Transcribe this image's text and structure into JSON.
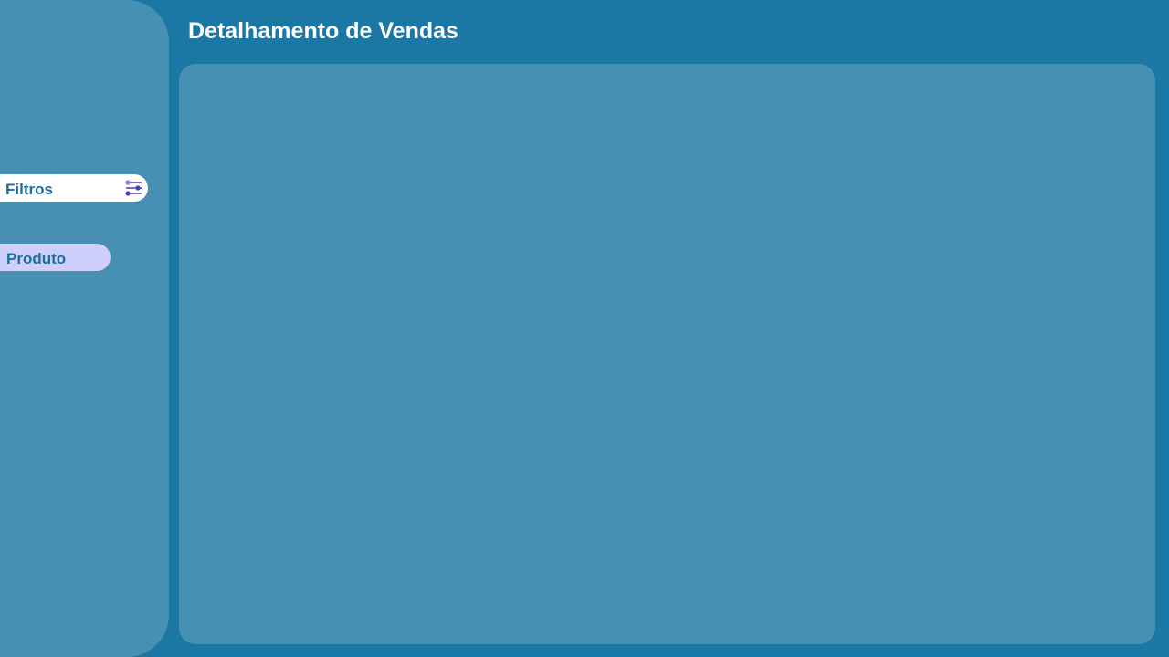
{
  "header": {
    "title": "Detalhamento de Vendas"
  },
  "sidebar": {
    "filters_button": {
      "label": "Filtros",
      "icon": "sliders-icon"
    },
    "produto_button": {
      "label": "Produto"
    }
  },
  "colors": {
    "background": "#1b77a4",
    "panel": "#4690b4",
    "pill_white": "#ffffff",
    "pill_lavender": "#cfcffb",
    "pill_text": "#1d6e9a",
    "icon_purple": "#4b3fb8",
    "icon_purple_light": "#8a7fe0"
  }
}
